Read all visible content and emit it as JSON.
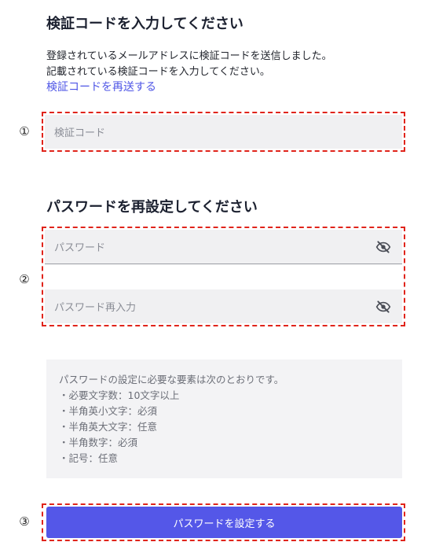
{
  "verify": {
    "title": "検証コードを入力してください",
    "desc_line1": "登録されているメールアドレスに検証コードを送信しました。",
    "desc_line2": "記載されている検証コードを入力してください。",
    "resend_link": "検証コードを再送する",
    "code_placeholder": "検証コード"
  },
  "reset": {
    "title": "パスワードを再設定してください",
    "password_placeholder": "パスワード",
    "password_confirm_placeholder": "パスワード再入力"
  },
  "requirements": {
    "intro": "パスワードの設定に必要な要素は次のとおりです。",
    "items": [
      "・必要文字数：10文字以上",
      "・半角英小文字：必須",
      "・半角英大文字：任意",
      "・半角数字：必須",
      "・記号：任意"
    ]
  },
  "submit_label": "パスワードを設定する",
  "markers": {
    "one": "①",
    "two": "②",
    "three": "③"
  },
  "colors": {
    "accent": "#5457e8",
    "link": "#4f56e6",
    "annotation_red": "#e0241b",
    "field_bg": "#f0f0f2"
  },
  "icons": {
    "password_toggle": "eye-slash-icon"
  }
}
